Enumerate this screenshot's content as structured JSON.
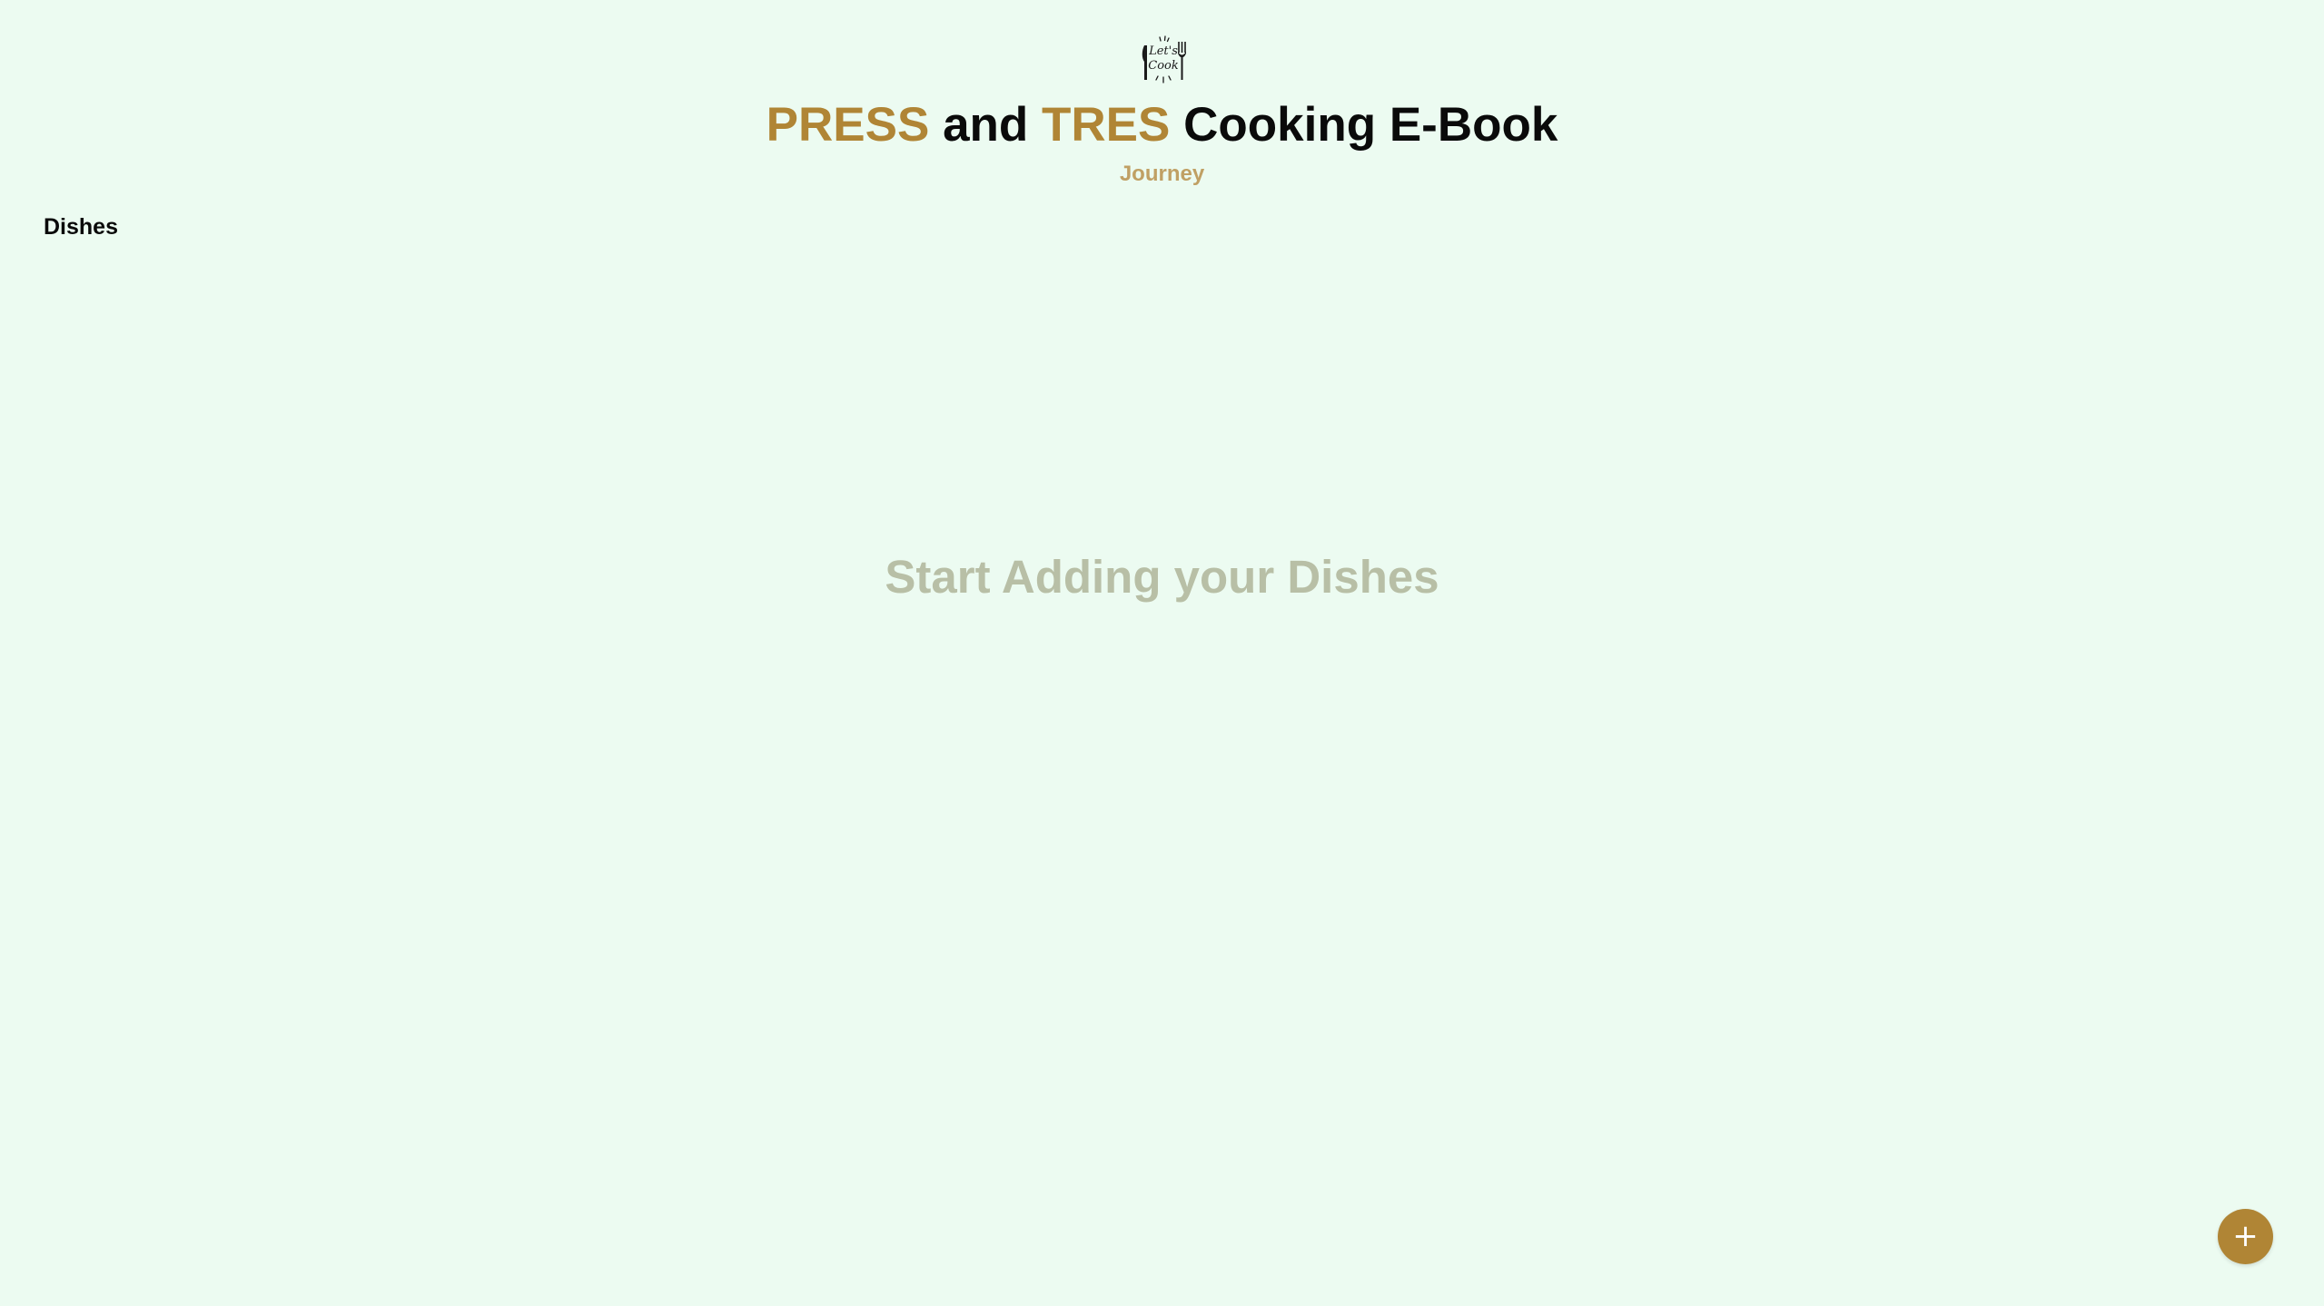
{
  "header": {
    "logo_text": "Let's Cook",
    "title_parts": {
      "part1": "PRESS",
      "part2": " and ",
      "part3": "TRES",
      "part4": " Cooking E-Book"
    },
    "subtitle": "Journey"
  },
  "main": {
    "section_label": "Dishes",
    "empty_message": "Start Adding your Dishes"
  },
  "fab": {
    "icon": "plus-icon",
    "label": "+"
  },
  "colors": {
    "background": "#ecfbf1",
    "accent": "#b08535",
    "subtitle": "#c0a064",
    "empty_text": "#b8bfa6",
    "text": "#0a0a0a"
  }
}
